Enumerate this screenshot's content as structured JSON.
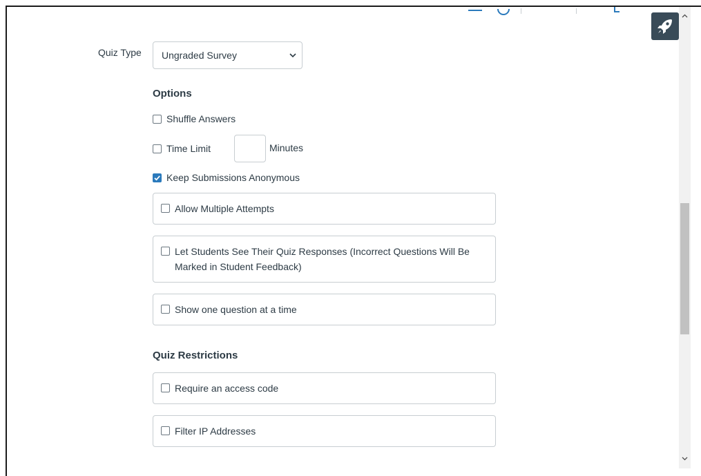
{
  "quiz_type": {
    "label": "Quiz Type",
    "selected": "Ungraded Survey"
  },
  "options": {
    "heading": "Options",
    "shuffle_answers": {
      "label": "Shuffle Answers",
      "checked": false
    },
    "time_limit": {
      "label": "Time Limit",
      "checked": false,
      "value": "",
      "unit_label": "Minutes"
    },
    "keep_anonymous": {
      "label": "Keep Submissions Anonymous",
      "checked": true
    },
    "allow_multiple_attempts": {
      "label": "Allow Multiple Attempts",
      "checked": false
    },
    "see_responses": {
      "label": "Let Students See Their Quiz Responses (Incorrect Questions Will Be Marked in Student Feedback)",
      "checked": false
    },
    "one_question": {
      "label": "Show one question at a time",
      "checked": false
    }
  },
  "restrictions": {
    "heading": "Quiz Restrictions",
    "access_code": {
      "label": "Require an access code",
      "checked": false
    },
    "filter_ip": {
      "label": "Filter IP Addresses",
      "checked": false
    }
  },
  "icons": {
    "rocket": "rocket-icon",
    "chevron_down": "chevron-down-icon",
    "scroll_up": "chevron-up-icon",
    "scroll_down": "chevron-down-icon"
  },
  "colors": {
    "accent": "#2b7abc",
    "text": "#2d3b45",
    "border": "#c7cdd1",
    "rocket_bg": "#394b58"
  }
}
